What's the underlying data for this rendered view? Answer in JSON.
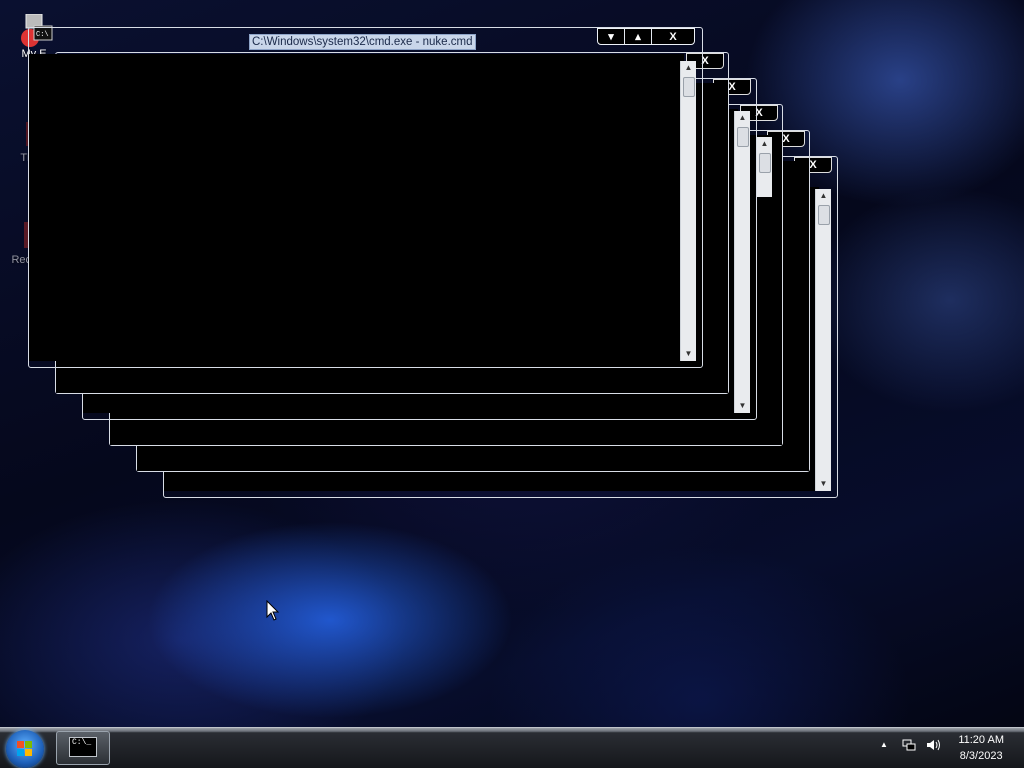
{
  "desktop": {
    "icons": [
      {
        "label": "My E",
        "icon": "cmd-computer-icon"
      },
      {
        "label": "Thi",
        "icon": "this-pc-icon"
      },
      {
        "label": "Recy",
        "icon": "recycle-bin-icon"
      }
    ]
  },
  "windows": {
    "front": {
      "title": "C:\\Windows\\system32\\cmd.exe - nuke.cmd",
      "caption_buttons": [
        "▾",
        "▴",
        "X"
      ]
    },
    "stack_close_glyph": "X"
  },
  "taskbar": {
    "start_icon": "windows-start-orb",
    "task_button_icon": "cmd-icon",
    "task_button_text": "C:\\_",
    "tray_icons": [
      "show-hidden-icons-arrow",
      "network-icon",
      "volume-icon"
    ],
    "tray_arrow": "▲",
    "time": "11:20 AM",
    "date": "8/3/2023"
  }
}
